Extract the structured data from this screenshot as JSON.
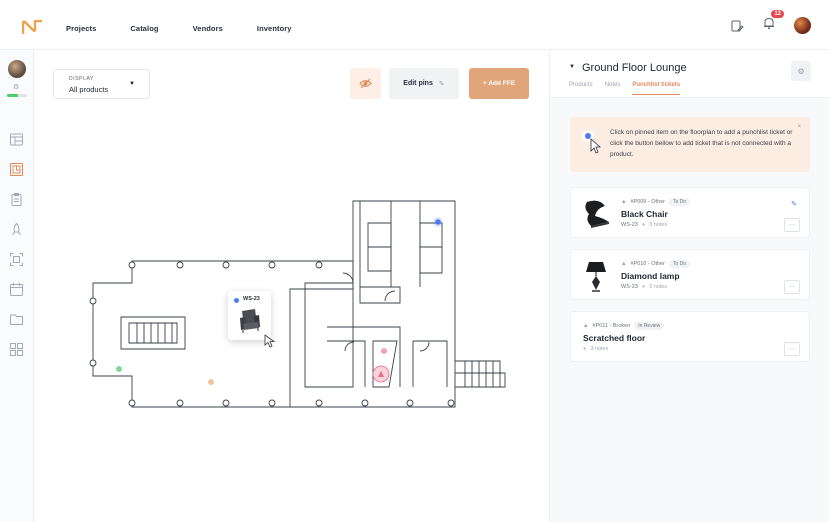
{
  "nav": {
    "items": [
      "Projects",
      "Catalog",
      "Vendors",
      "Inventory"
    ]
  },
  "top": {
    "notification_count": "12"
  },
  "sidebar": {
    "progress_fraction": 0.55,
    "icons": [
      "layout-icon",
      "floorplan-icon",
      "clipboard-icon",
      "rocket-icon",
      "scan-icon",
      "calendar-icon",
      "folder-icon",
      "grid-icon"
    ]
  },
  "toolbar": {
    "display_label": "DISPLAY",
    "display_value": "All products",
    "edit_pins": "Edit pins",
    "add_ffe": "+ Add FFE"
  },
  "popup": {
    "label": "WS-23"
  },
  "panel": {
    "title": "Ground Floor Lounge",
    "tabs": [
      {
        "label": "Products",
        "active": false
      },
      {
        "label": "Notes",
        "active": false
      },
      {
        "label": "Punchlist tickets",
        "active": true
      }
    ],
    "tip": "Click on pinned item on the floorplan to add a punchlist ticket or click the button bellow to add ticket that is not connected with a product.",
    "tickets": [
      {
        "id": "#P009 - Other",
        "status": "To Do",
        "name": "Black Chair",
        "code": "WS-23",
        "notes": "3 notes"
      },
      {
        "id": "#P010 - Other",
        "status": "To Do",
        "name": "Diamond lamp",
        "code": "WS-23",
        "notes": "3 notes"
      },
      {
        "id": "#P011 - Broken",
        "status": "In Review",
        "name": "Scratched floor",
        "code": "",
        "notes": "3 notes"
      }
    ]
  },
  "colors": {
    "accent": "#e0a67a",
    "pin_blue": "#4a7df0",
    "badge_red": "#e5484d"
  }
}
